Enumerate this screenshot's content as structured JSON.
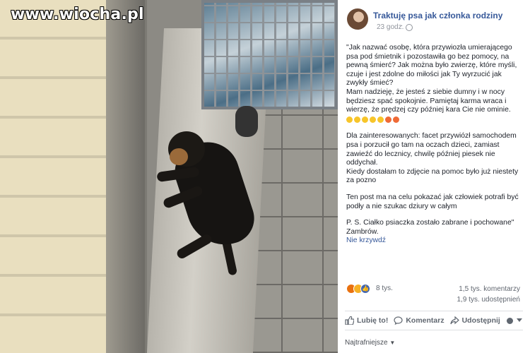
{
  "watermark": "www.wiocha.pl",
  "post": {
    "page_name": "Traktuję psa jak członka rodziny",
    "time": "23 godz.",
    "paragraphs": [
      "\"Jak nazwać osobę, która przywiozła umierającego psa pod śmietnik i pozostawiła go bez pomocy, na pewną śmierć? Jak można było zwierzę, które myśli, czuje i jest zdolne do miłości jak Ty wyrzucić jak zwykły śmieć?\nMam nadzieję, że jesteś z siebie dumny i w nocy będziesz spać spokojnie. Pamiętaj karma wraca i wierzę, że prędzej czy później kara Cie nie ominie.",
      "Dla zainteresowanych: facet przywiózł samochodem psa i porzucił go tam na oczach dzieci, zamiast zawieźć do lecznicy, chwilę później piesek nie oddychał.\nKiedy dostałam to zdjęcie na pomoc było już niestety za pozno",
      "Ten post ma na celu pokazać jak człowiek potrafi być podły a nie szukac dziury w całym",
      "P. S. Ciałko psiaczka zostało zabrane i pochowane\"\nZambrów."
    ],
    "see_less": "Nie krzywdź"
  },
  "stats": {
    "reactions": "8 tys.",
    "comments": "1,5 tys. komentarzy",
    "shares": "1,9 tys. udostępnień"
  },
  "actions": {
    "like": "Lubię to!",
    "comment": "Komentarz",
    "share": "Udostępnij"
  },
  "sort": "Najtrafniejsze"
}
